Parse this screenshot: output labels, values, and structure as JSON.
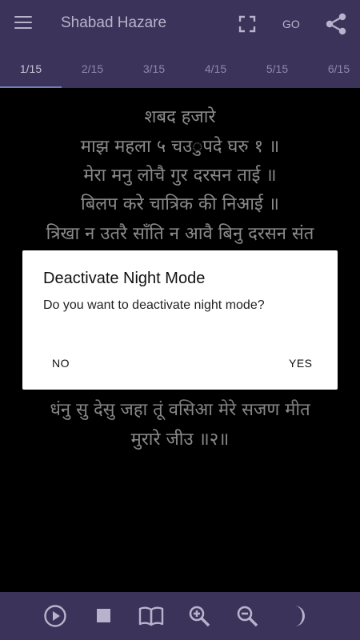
{
  "appbar": {
    "title": "Shabad Hazare",
    "go_label": "GO",
    "icons": [
      "menu-icon",
      "fullscreen-icon",
      "share-icon"
    ]
  },
  "tabs": [
    {
      "label": "1/15",
      "active": true
    },
    {
      "label": "2/15",
      "active": false
    },
    {
      "label": "3/15",
      "active": false
    },
    {
      "label": "4/15",
      "active": false
    },
    {
      "label": "5/15",
      "active": false
    },
    {
      "label": "6/15",
      "active": false
    }
  ],
  "content": {
    "lines": [
      "शबद हजारे",
      "माझ महला ५ चउुपदे घरु १ ॥",
      "मेरा मनु लोचै गुर दरसन ताई ॥",
      "बिलप करे चात्रिक की निआई ॥",
      "त्रिखा न उतरै साँति न आवै बिनु दरसन संत",
      "धंनु सु देसु जहा तूं वसिआ मेरे सजण मीत",
      "मुरारे जीउ ॥२॥"
    ]
  },
  "dialog": {
    "title": "Deactivate Night Mode",
    "message": "Do you want to deactivate night mode?",
    "no_label": "NO",
    "yes_label": "YES"
  },
  "bottombar": {
    "icons": [
      "play-icon",
      "stop-icon",
      "book-icon",
      "zoom-in-icon",
      "zoom-out-icon",
      "moon-icon"
    ]
  },
  "colors": {
    "bar_bg": "#3b3359",
    "icon": "#b8b2cc",
    "text": "#d4d4d4"
  }
}
